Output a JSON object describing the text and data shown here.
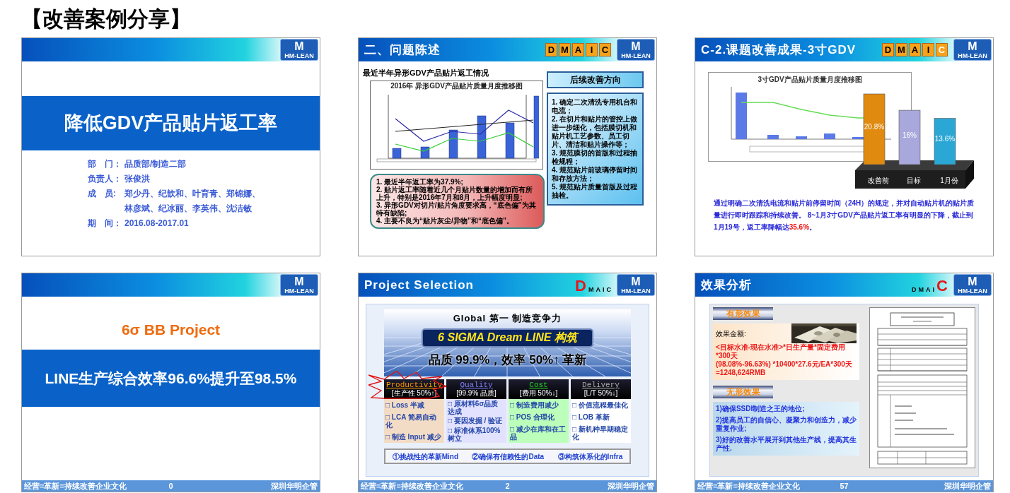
{
  "page_title": "【改善案例分享】",
  "slides": [
    {
      "kind": "cover",
      "logo": {
        "mark": "M",
        "name": "HM-LEAN"
      },
      "title": "降低GDV产品贴片返工率",
      "details": [
        {
          "label": "部　门：",
          "lines": [
            "品质部/制造二部"
          ]
        },
        {
          "label": "负责人：",
          "lines": [
            "张俊洪"
          ]
        },
        {
          "label": "成　员:",
          "lines": [
            "郑少丹、纪歆和、叶育青、郑锦娜、",
            "林彦斌、纪冰丽、李英伟、沈洁敏"
          ]
        },
        {
          "label": "期　间：",
          "lines": [
            "2016.08-2017.01"
          ]
        }
      ]
    },
    {
      "kind": "problem",
      "title": "二、问题陈述",
      "phases": [
        {
          "letter": "D",
          "selected": false
        },
        {
          "letter": "M",
          "selected": false
        },
        {
          "letter": "A",
          "selected": false
        },
        {
          "letter": "I",
          "selected": false
        },
        {
          "letter": "C",
          "selected": false
        }
      ],
      "logo": {
        "mark": "M",
        "name": "HM-LEAN"
      },
      "subtitle": "最近半年异形GDV产品贴片返工情况",
      "chart_title": "2016年 异形GDV产品贴片质量月度推移图",
      "findings": [
        "1. 最近半年返工率为37.9%;",
        "2. 贴片返工率随着近几个月贴片数量的增加而有所上升，特别是2016年7月和8月，上升幅度明显;",
        "3. 异形GDV对切片/贴片角度要求高，“底色偏”为其特有缺陷;",
        "4. 主要不良为“贴片灰尘/异物”和“底色偏”。"
      ],
      "direction_title": "后续改善方向",
      "directions": [
        "1. 确定二次清洗专用机台和电流；",
        "2. 在切片和贴片的管控上做进一步细化，包括膜切机和贴片机工艺参数、员工切片、清洁和贴片操作等；",
        "3. 规范膜切的首版和过程抽检规程；",
        "4. 规范贴片前玻璃停留时间和存放方法；",
        "5. 规范贴片质量首版及过程抽检。"
      ]
    },
    {
      "kind": "result",
      "title": "C-2.课题改善成果-3寸GDV",
      "phases": [
        {
          "letter": "D",
          "selected": false
        },
        {
          "letter": "M",
          "selected": false
        },
        {
          "letter": "A",
          "selected": false
        },
        {
          "letter": "I",
          "selected": false
        },
        {
          "letter": "C",
          "selected": true
        }
      ],
      "logo": {
        "mark": "M",
        "name": "HM-LEAN"
      },
      "trend_chart_title": "3寸GDV产品贴片质量月度推移图",
      "chart_data": {
        "type": "bar",
        "categories": [
          "改善前",
          "目标",
          "1月份"
        ],
        "values": [
          20.8,
          16,
          13.6
        ],
        "data_labels": true,
        "value_labels": [
          "20.8%",
          "16%",
          "13.6%"
        ]
      },
      "summary": {
        "text": "通过明确二次清洗电流和贴片前停留时间（24H）的规定，并对自动贴片机的贴片质量进行即时跟踪和持续改善。 8~1月3寸GDV产品贴片返工率有明显的下降，截止到1月19号，返工率降幅达",
        "highlight": "35.6%",
        "tail": "。"
      }
    },
    {
      "kind": "project",
      "logo": {
        "mark": "M",
        "name": "HM-LEAN"
      },
      "tag": "6σ BB Project",
      "headline": "LINE生产综合效率96.6%提升至98.5%",
      "footer": {
        "motto": "经营=革新=持续改善企业文化",
        "page": "0",
        "company": "深圳华明企管"
      }
    },
    {
      "kind": "selection",
      "title": "Project Selection",
      "phases": [
        {
          "letter": "D",
          "selected": true
        },
        {
          "letter": "M",
          "selected": false
        },
        {
          "letter": "A",
          "selected": false
        },
        {
          "letter": "I",
          "selected": false
        },
        {
          "letter": "C",
          "selected": false
        }
      ],
      "logo": {
        "mark": "M",
        "name": "HM-LEAN"
      },
      "goal": "Global 第一 制造竞争力",
      "slogan": "6 SIGMA Dream LINE 构筑",
      "target": "品质 99.9%，效率 50%↑ 革新",
      "columns": [
        {
          "name": "Productivity",
          "sub": "[生产性 50%↑]",
          "color": "#ff9900",
          "highlighted": true,
          "items": [
            "□ Loss 半减",
            "□ LCA 简易自动化",
            "□ 制造 Input 减少"
          ]
        },
        {
          "name": "Quality",
          "sub": "[99.9% 品质]",
          "color": "#8080ff",
          "highlighted": false,
          "items": [
            "□ 原材料6σ品质达成",
            "□ 要因发掘 / 验证",
            "□ 标准体系100% 树立"
          ]
        },
        {
          "name": "Cost",
          "sub": "[费用 50%↓]",
          "color": "#22dd22",
          "highlighted": false,
          "items": [
            "□ 制造费用减少",
            "□ POS 合理化",
            "□ 减少在库和在工品"
          ]
        },
        {
          "name": "Delivery",
          "sub": "[L/T 50%↓]",
          "color": "#aaaaaa",
          "highlighted": false,
          "items": [
            "□ 价值流程最佳化",
            "□ LOB 革新",
            "□ 新机种早期稳定化"
          ]
        }
      ],
      "principles": [
        "①挑战性的革新Mind",
        "②确保有信赖性的Data",
        "③构筑体系化的Infra"
      ],
      "footer": {
        "motto": "经营=革新=持续改善企业文化",
        "page": "2",
        "company": "深圳华明企管"
      }
    },
    {
      "kind": "effect",
      "title": "效果分析",
      "phases": [
        {
          "letter": "D",
          "selected": false
        },
        {
          "letter": "M",
          "selected": false
        },
        {
          "letter": "A",
          "selected": false
        },
        {
          "letter": "I",
          "selected": false
        },
        {
          "letter": "C",
          "selected": true
        }
      ],
      "logo": {
        "mark": "M",
        "name": "HM-LEAN"
      },
      "tangible": {
        "label": "有形效果",
        "amount_label": "效果金额:",
        "formula": [
          "<目标水准-现在水准>*日生产量*固定费用*300天",
          "(98.08%-96.63%) *10400*27.6元/EA*300天",
          "=1248,624RMB"
        ]
      },
      "intangible": {
        "label": "无形效果",
        "items": [
          "1)确保SSDI制造之王的地位;",
          "2)提高员工的自信心、凝聚力和创造力，减少重复作业;",
          "3)好的改善水平展开到其他生产线，提高其生产性."
        ]
      },
      "footer": {
        "motto": "经营=革新=持续改善企业文化",
        "page": "57",
        "company": "深圳华明企管"
      }
    }
  ]
}
